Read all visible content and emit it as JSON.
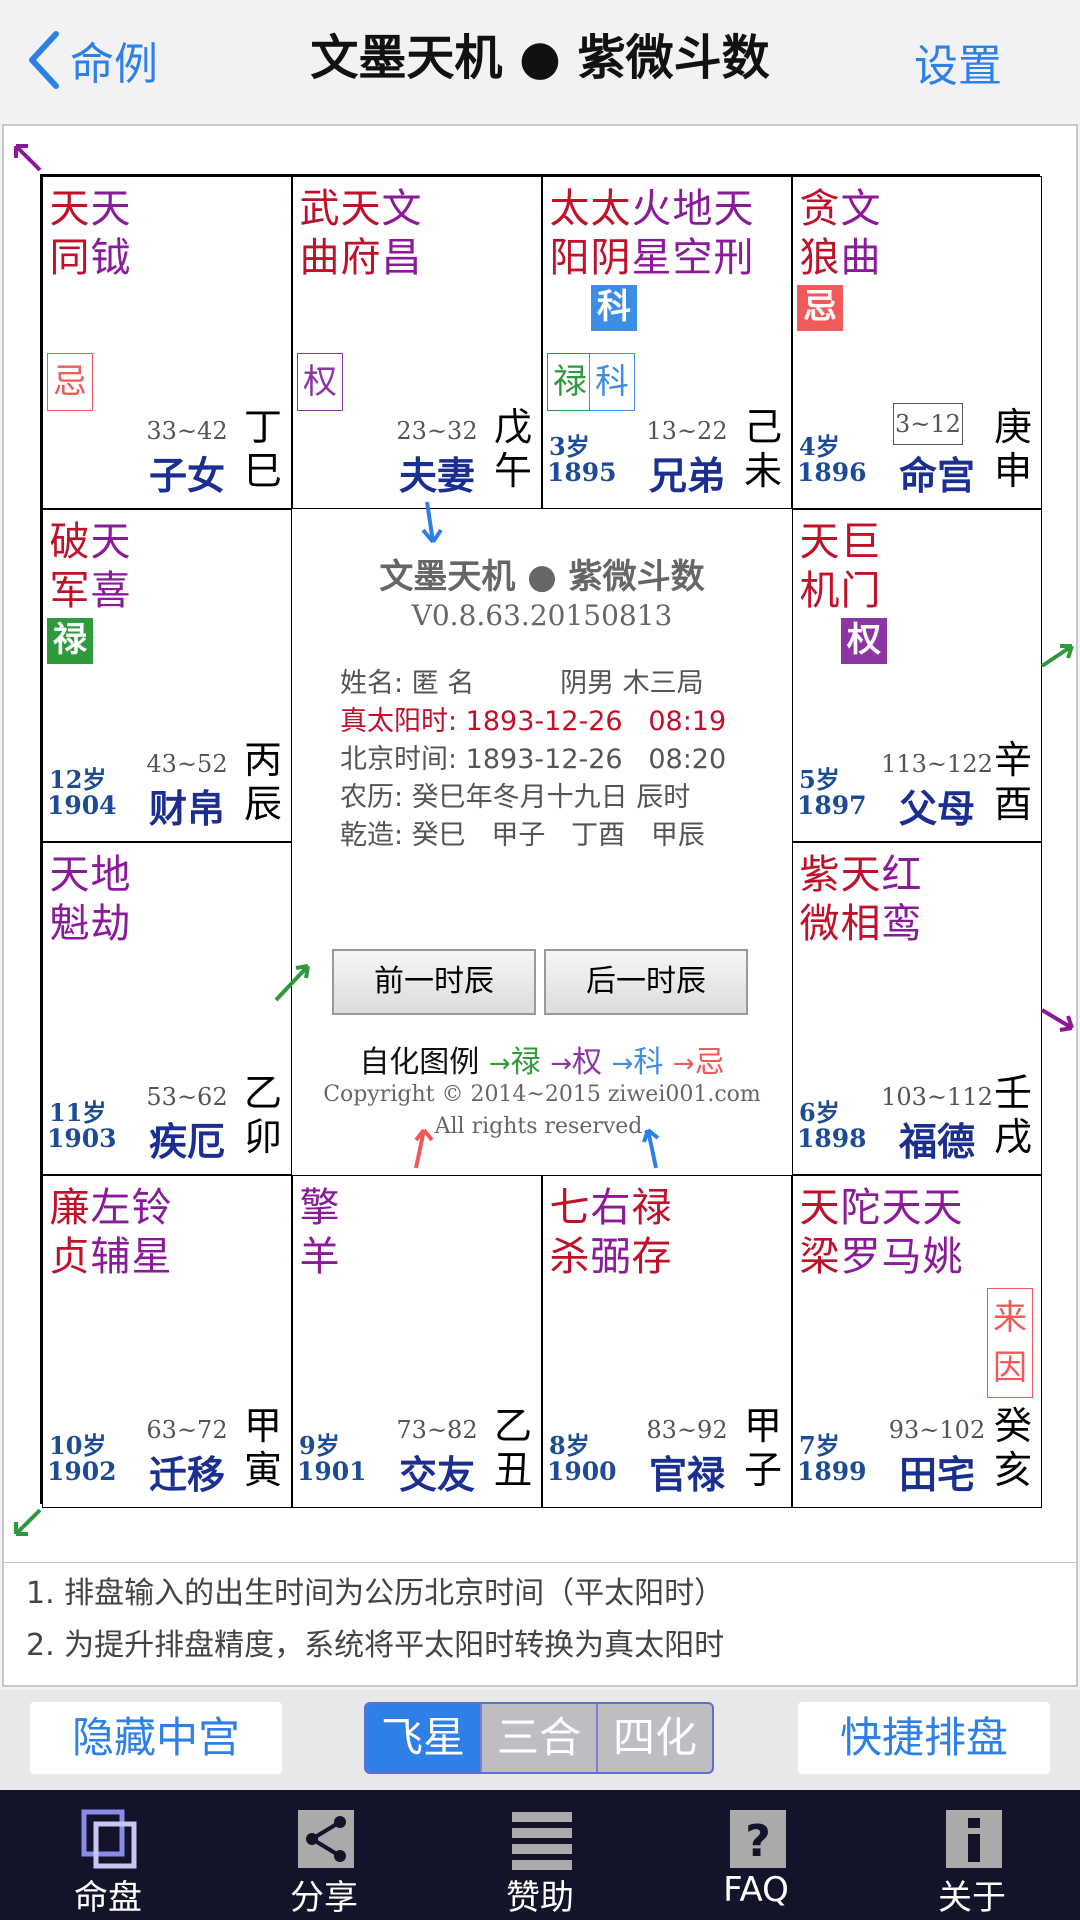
{
  "nav": {
    "back_label": "命例",
    "title": "文墨天机 ● 紫微斗数",
    "settings_label": "设置"
  },
  "colors": {
    "accent": "#2f80e6",
    "lu": "#2e9a3c",
    "quan": "#8e35a5",
    "ke": "#3d8de6",
    "ji": "#f05a5a",
    "palace": "#1a2f8f"
  },
  "cells": [
    {
      "key": "si",
      "stars": [
        [
          "天同",
          "red"
        ],
        [
          "天钺",
          "pur"
        ]
      ],
      "badges": [
        {
          "t": "忌",
          "type": "outline",
          "color": "#f05a5a"
        }
      ],
      "range": "33~42",
      "palace": "子女",
      "gz": "丁巳",
      "age": "",
      "year": ""
    },
    {
      "key": "wu",
      "stars": [
        [
          "武曲",
          "red"
        ],
        [
          "天府",
          "red"
        ],
        [
          "文昌",
          "pur"
        ]
      ],
      "badges": [
        {
          "t": "权",
          "type": "outline",
          "color": "#8e35a5"
        }
      ],
      "range": "23~32",
      "palace": "夫妻",
      "gz": "戊午",
      "age": "",
      "year": ""
    },
    {
      "key": "wei",
      "stars": [
        [
          "太阳",
          "red"
        ],
        [
          "太阴",
          "red"
        ],
        [
          "火星",
          "pur"
        ],
        [
          "地空",
          "pur"
        ],
        [
          "天刑",
          "pur"
        ]
      ],
      "badges": [
        {
          "t": "科",
          "type": "fill",
          "cls": "b-ke"
        },
        {
          "t": "禄",
          "type": "outline",
          "color": "#2e9a3c"
        },
        {
          "t": "科",
          "type": "outline",
          "color": "#3d8de6"
        }
      ],
      "range": "13~22",
      "palace": "兄弟",
      "gz": "己未",
      "age": "3岁",
      "year": "1895"
    },
    {
      "key": "shen",
      "stars": [
        [
          "贪狼",
          "red"
        ],
        [
          "文曲",
          "pur"
        ]
      ],
      "badges": [
        {
          "t": "忌",
          "type": "fill",
          "cls": "b-ji"
        }
      ],
      "range": "3~12",
      "palace": "命宫",
      "gz": "庚申",
      "age": "4岁",
      "year": "1896"
    },
    {
      "key": "chen",
      "stars": [
        [
          "破军",
          "red"
        ],
        [
          "天喜",
          "pur"
        ]
      ],
      "badges": [
        {
          "t": "禄",
          "type": "fill",
          "cls": "b-lu"
        }
      ],
      "range": "43~52",
      "palace": "财帛",
      "gz": "丙辰",
      "age": "12岁",
      "year": "1904"
    },
    {
      "key": "you",
      "stars": [
        [
          "天机",
          "red"
        ],
        [
          "巨门",
          "red"
        ]
      ],
      "badges": [
        {
          "t": "权",
          "type": "fill",
          "cls": "b-quan"
        }
      ],
      "range": "113~122",
      "palace": "父母",
      "gz": "辛酉",
      "age": "5岁",
      "year": "1897"
    },
    {
      "key": "mao",
      "stars": [
        [
          "天魁",
          "pur"
        ],
        [
          "地劫",
          "pur"
        ]
      ],
      "badges": [],
      "range": "53~62",
      "palace": "疾厄",
      "gz": "乙卯",
      "age": "11岁",
      "year": "1903"
    },
    {
      "key": "xu",
      "stars": [
        [
          "紫微",
          "red"
        ],
        [
          "天相",
          "red"
        ],
        [
          "红鸾",
          "pur"
        ]
      ],
      "badges": [],
      "range": "103~112",
      "palace": "福德",
      "gz": "壬戌",
      "age": "6岁",
      "year": "1898"
    },
    {
      "key": "yin",
      "stars": [
        [
          "廉贞",
          "red"
        ],
        [
          "左辅",
          "pur"
        ],
        [
          "铃星",
          "pur"
        ]
      ],
      "badges": [],
      "range": "63~72",
      "palace": "迁移",
      "gz": "甲寅",
      "age": "10岁",
      "year": "1902"
    },
    {
      "key": "chou",
      "stars": [
        [
          "擎羊",
          "pur"
        ]
      ],
      "badges": [],
      "range": "73~82",
      "palace": "交友",
      "gz": "乙丑",
      "age": "9岁",
      "year": "1901"
    },
    {
      "key": "zi",
      "stars": [
        [
          "七杀",
          "red"
        ],
        [
          "右弼",
          "pur"
        ],
        [
          "禄存",
          "red"
        ]
      ],
      "badges": [],
      "range": "83~92",
      "palace": "官禄",
      "gz": "甲子",
      "age": "8岁",
      "year": "1900"
    },
    {
      "key": "hai",
      "stars": [
        [
          "天梁",
          "red"
        ],
        [
          "陀罗",
          "pur"
        ],
        [
          "天马",
          "pur"
        ],
        [
          "天姚",
          "pur"
        ]
      ],
      "badges": [
        {
          "t": "来因",
          "type": "laiyin"
        }
      ],
      "range": "93~102",
      "palace": "田宅",
      "gz": "癸亥",
      "age": "7岁",
      "year": "1899"
    }
  ],
  "center": {
    "title": "文墨天机 ● 紫微斗数",
    "version": "V0.8.63.20150813",
    "name_line": "姓名: 匿 名          阴男 木三局",
    "true_solar": "真太阳时: 1893-12-26   08:19",
    "beijing": "北京时间: 1893-12-26   08:20",
    "lunar": "农历: 癸巳年冬月十九日 辰时",
    "qianzao": "乾造: 癸巳   甲子   丁酉   甲辰",
    "prev_btn": "前一时辰",
    "next_btn": "后一时辰",
    "legend_label": "自化图例",
    "legend": [
      {
        "t": "禄",
        "color": "#2e9a3c"
      },
      {
        "t": "权",
        "color": "#8e35a5"
      },
      {
        "t": "科",
        "color": "#3d8de6"
      },
      {
        "t": "忌",
        "color": "#f05a5a"
      }
    ],
    "copyright": "Copyright © 2014~2015 ziwei001.com",
    "rights": "All rights reserved."
  },
  "notes": [
    "1. 排盘输入的出生时间为公历北京时间（平太阳时）",
    "2. 为提升排盘精度，系统将平太阳时转换为真太阳时"
  ],
  "controls": {
    "hide_center": "隐藏中宫",
    "segments": [
      "飞星",
      "三合",
      "四化"
    ],
    "active_segment": 0,
    "quick": "快捷排盘"
  },
  "tabs": [
    {
      "label": "命盘",
      "icon": "chart-icon"
    },
    {
      "label": "分享",
      "icon": "share-icon"
    },
    {
      "label": "赞助",
      "icon": "menu-icon"
    },
    {
      "label": "FAQ",
      "icon": "faq-icon"
    },
    {
      "label": "关于",
      "icon": "info-icon"
    }
  ]
}
